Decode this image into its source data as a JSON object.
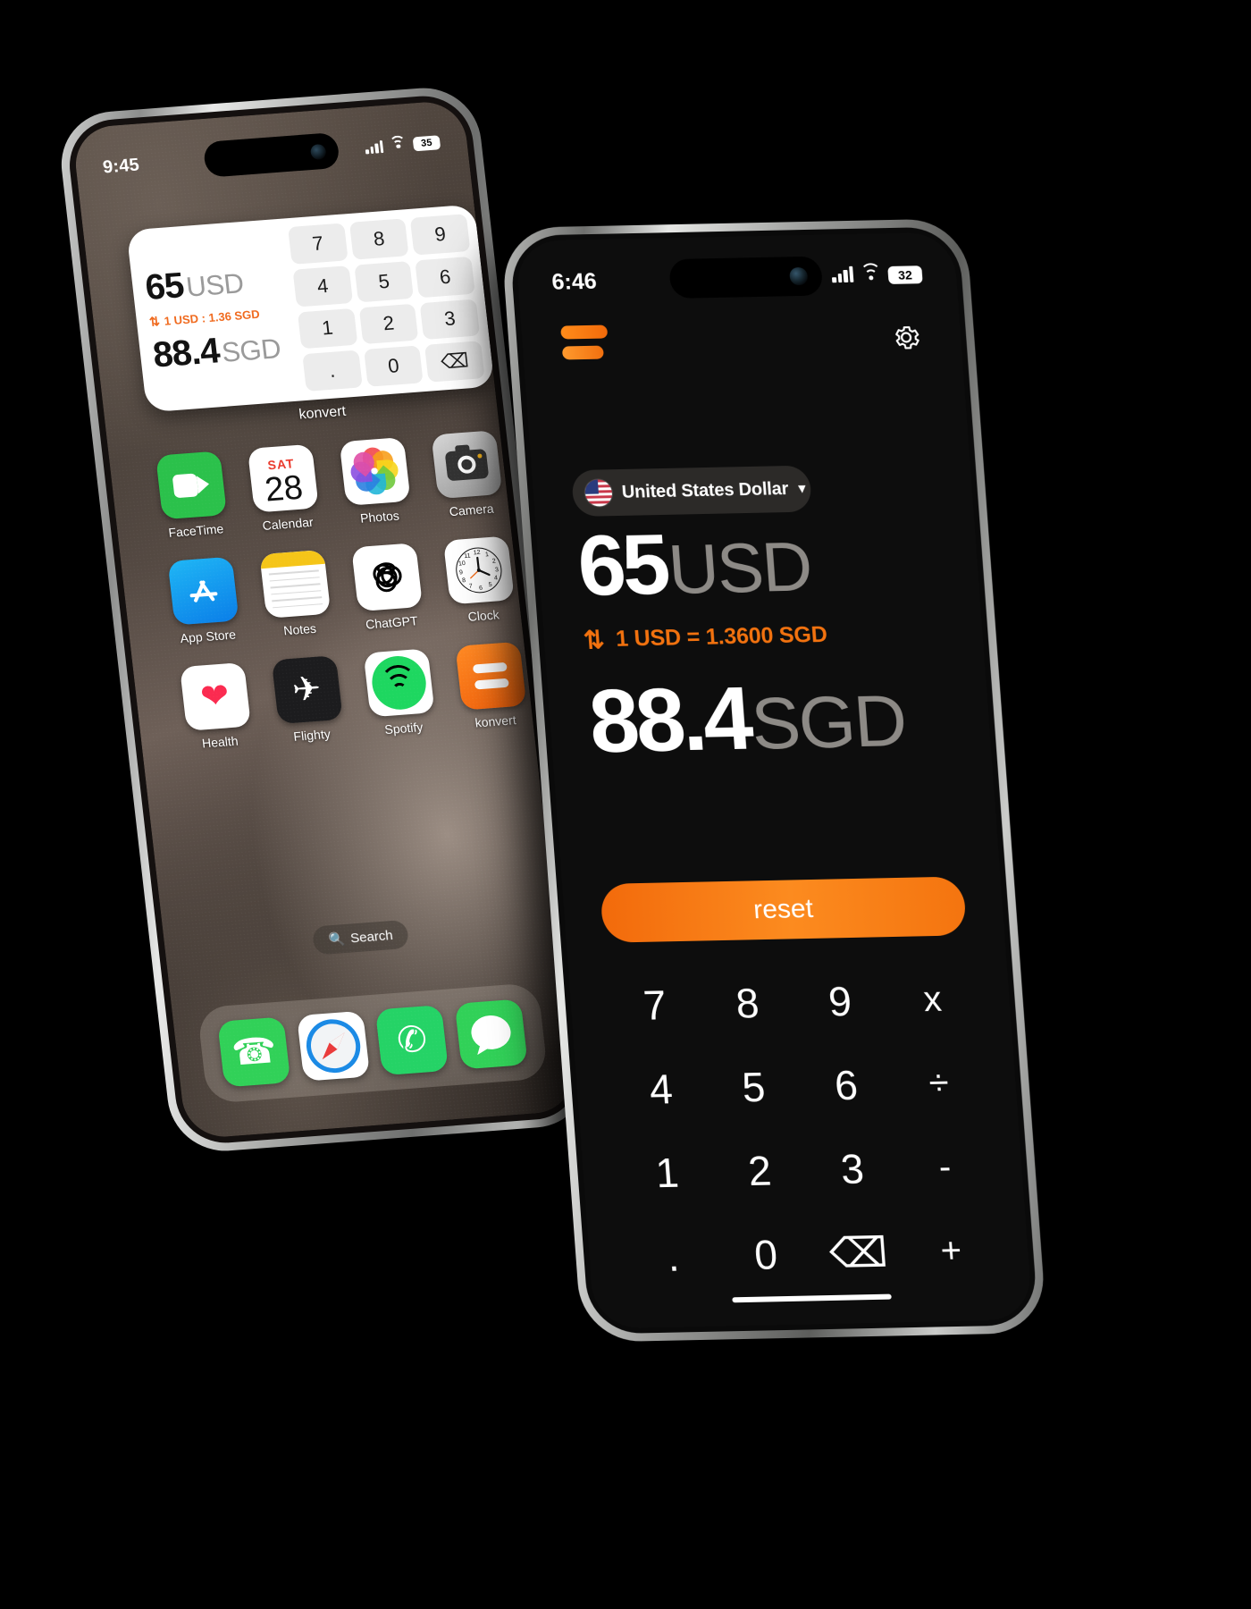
{
  "back_phone": {
    "status": {
      "time": "9:45",
      "battery": "35",
      "signal_icon": "cellular-bars-icon",
      "wifi_icon": "wifi-icon"
    },
    "widget": {
      "label": "konvert",
      "from_amount": "65",
      "from_currency": "USD",
      "rate": "1 USD : 1.36 SGD",
      "rate_arrow": "⇅",
      "to_amount": "88.4",
      "to_currency": "SGD",
      "keys": [
        "7",
        "8",
        "9",
        "4",
        "5",
        "6",
        "1",
        "2",
        "3",
        ".",
        "0",
        "⌫"
      ]
    },
    "apps": [
      {
        "name": "FaceTime",
        "icon": "facetime-icon"
      },
      {
        "name": "Calendar",
        "icon": "calendar-icon",
        "day": "SAT",
        "date": "28"
      },
      {
        "name": "Photos",
        "icon": "photos-icon"
      },
      {
        "name": "Camera",
        "icon": "camera-icon"
      },
      {
        "name": "App Store",
        "icon": "appstore-icon"
      },
      {
        "name": "Notes",
        "icon": "notes-icon"
      },
      {
        "name": "ChatGPT",
        "icon": "chatgpt-icon"
      },
      {
        "name": "Clock",
        "icon": "clock-icon"
      },
      {
        "name": "Health",
        "icon": "health-icon"
      },
      {
        "name": "Flighty",
        "icon": "flighty-icon"
      },
      {
        "name": "Spotify",
        "icon": "spotify-icon"
      },
      {
        "name": "konvert",
        "icon": "konvert-icon"
      }
    ],
    "search": {
      "label": "Search",
      "icon": "search-icon"
    },
    "dock": [
      {
        "name": "Phone",
        "icon": "phone-icon"
      },
      {
        "name": "Safari",
        "icon": "safari-icon"
      },
      {
        "name": "WhatsApp",
        "icon": "whatsapp-icon"
      },
      {
        "name": "Messages",
        "icon": "messages-icon"
      }
    ]
  },
  "front_phone": {
    "status": {
      "time": "6:46",
      "battery": "32",
      "signal_icon": "cellular-bars-icon",
      "wifi_icon": "wifi-icon"
    },
    "app": {
      "logo_name": "konvert-logo",
      "settings_icon": "gear-icon",
      "currency_selector": {
        "flag": "us-flag-icon",
        "name": "United States Dollar",
        "chevron": "chevron-down-icon"
      },
      "from_amount": "65",
      "from_currency": "USD",
      "rate_arrow": "⇅",
      "rate_text": "1 USD = 1.3600 SGD",
      "to_amount": "88.4",
      "to_currency": "SGD",
      "reset_label": "reset",
      "keypad": [
        "7",
        "8",
        "9",
        "x",
        "4",
        "5",
        "6",
        "÷",
        "1",
        "2",
        "3",
        "-",
        ".",
        "0",
        "⌫",
        "+"
      ]
    }
  },
  "colors": {
    "accent_orange": "#f2720f",
    "accent_orange_light": "#fc8b1f",
    "screen_black": "#0d0d0d",
    "muted_gray": "#8d8a86",
    "background": "#000000"
  }
}
